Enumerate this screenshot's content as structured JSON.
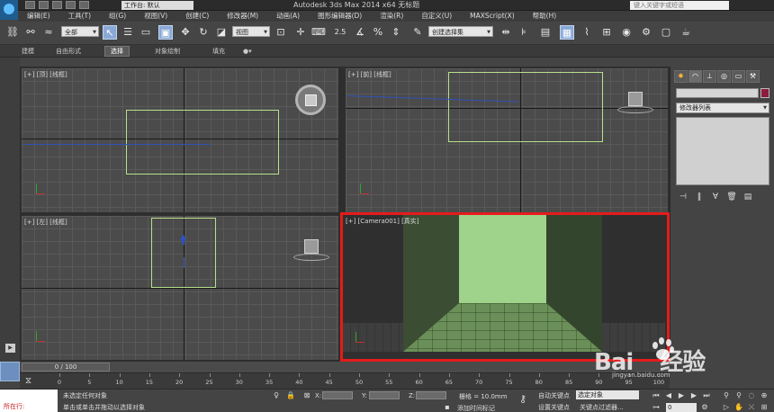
{
  "title_bar": {
    "workspace": "工作台: 默认",
    "window_title": "Autodesk 3ds Max  2014 x64      无标题",
    "search_placeholder": "键入关键字或短语"
  },
  "menu": [
    "编辑(E)",
    "工具(T)",
    "组(G)",
    "视图(V)",
    "创建(C)",
    "修改器(M)",
    "动画(A)",
    "图形编辑器(D)",
    "渲染(R)",
    "自定义(U)",
    "MAXScript(X)",
    "帮助(H)"
  ],
  "toolbar": {
    "selection_filter": "全部",
    "ref_coord": "视图",
    "snap_angle_label": "2.5",
    "named_selection_placeholder": "创建选择集"
  },
  "ribbon_tabs": [
    "建模",
    "自由形式",
    "选择",
    "对象绘制",
    "填充"
  ],
  "ribbon_active": "选择",
  "viewports": {
    "top": "[+] [顶] [线框]",
    "front": "[+] [前] [线框]",
    "left": "[+] [左] [线框]",
    "camera": "[+] [Camera001] [真实]"
  },
  "command_panel": {
    "modifier_list": "修改器列表"
  },
  "time_slider": {
    "label": "0 / 100"
  },
  "trackbar": {
    "ticks": [
      "0",
      "5",
      "10",
      "15",
      "20",
      "25",
      "30",
      "35",
      "40",
      "45",
      "50",
      "55",
      "60",
      "65",
      "70",
      "75",
      "80",
      "85",
      "90",
      "95",
      "100"
    ]
  },
  "status": {
    "listener": "所在行:",
    "line1": "未选定任何对象",
    "line2": "单击或单击并拖动以选择对象",
    "x_label": "X:",
    "y_label": "Y:",
    "z_label": "Z:",
    "grid": "栅格 = 10.0mm",
    "add_time_tag": "添加时间标记",
    "auto_key": "自动关键点",
    "set_key": "设置关键点",
    "selected_dd": "选定对象",
    "key_filters": "关键点过滤器...",
    "frame": "0"
  },
  "watermark": {
    "brand": "Bai",
    "brand_suffix": "经验",
    "url": "jingyan.baidu.com"
  },
  "colors": {
    "selection_highlight": "#e51b1b",
    "wireframe_box": "#b8e08c",
    "back_wall": "#9fd28a"
  }
}
